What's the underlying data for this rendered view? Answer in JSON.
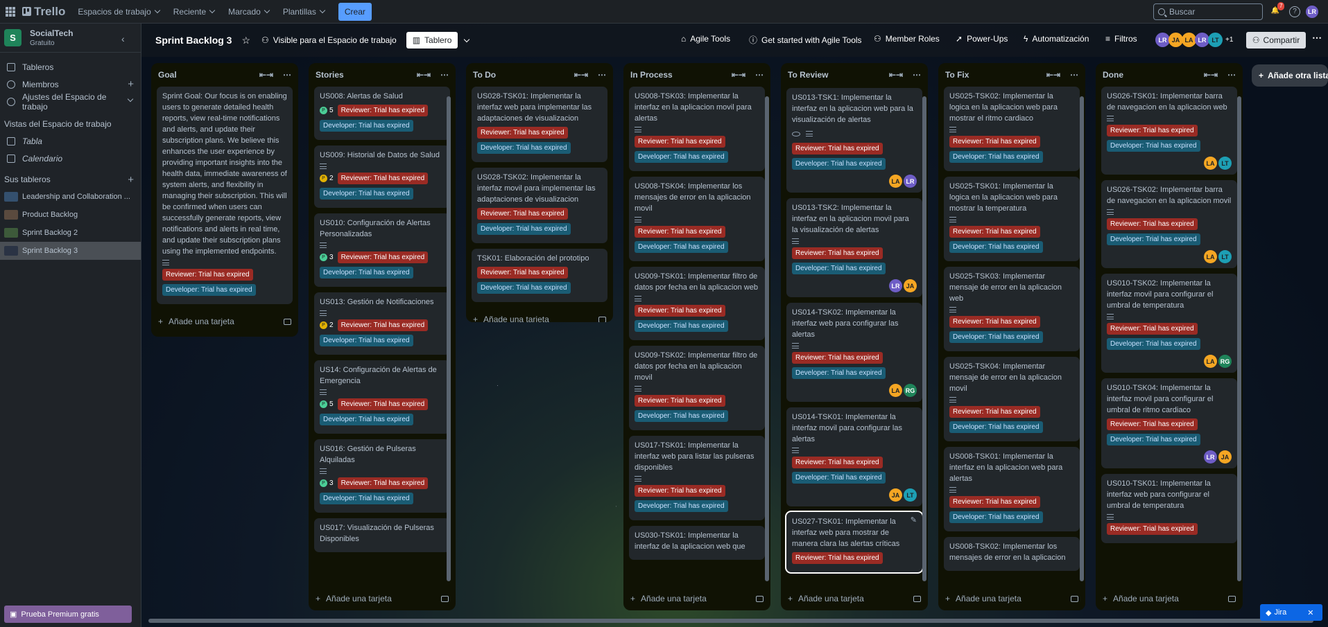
{
  "topbar": {
    "app_name": "Trello",
    "nav": [
      "Espacios de trabajo",
      "Reciente",
      "Marcado",
      "Plantillas"
    ],
    "create_label": "Crear",
    "search_placeholder": "Buscar",
    "notification_count": "7",
    "account_initials": "LR"
  },
  "sidebar": {
    "workspace_initial": "S",
    "workspace_name": "SocialTech",
    "workspace_plan": "Gratuito",
    "items": [
      "Tableros",
      "Miembros",
      "Ajustes del Espacio de trabajo"
    ],
    "views_heading": "Vistas del Espacio de trabajo",
    "views": [
      "Tabla",
      "Calendario"
    ],
    "boards_heading": "Sus tableros",
    "boards": [
      "Leadership and Collaboration ...",
      "Product Backlog",
      "Sprint Backlog 2",
      "Sprint Backlog 3"
    ],
    "premium_label": "Prueba Premium gratis"
  },
  "board_header": {
    "title": "Sprint Backlog 3",
    "visibility": "Visible para el Espacio de trabajo",
    "view": "Tablero",
    "agile_tools": "Agile Tools",
    "get_started": "Get started with Agile Tools",
    "member_roles": "Member Roles",
    "power_ups": "Power-Ups",
    "automation": "Automatización",
    "filters": "Filtros",
    "members": [
      "LR",
      "JA",
      "LA",
      "LR",
      "LT"
    ],
    "more_members": "+1",
    "share_label": "Compartir"
  },
  "labels": {
    "reviewer": "Reviewer: Trial has expired",
    "developer": "Developer: Trial has expired",
    "add_card": "Añade una tarjeta",
    "add_list": "Añade otra lista"
  },
  "colors": {
    "LA": "#f5a623",
    "LR": "#6e5dc6",
    "JA": "#f5a623",
    "RG": "#1f845a",
    "LT": "#1d9fb4"
  },
  "lists": [
    {
      "name": "Goal",
      "cards": [
        {
          "title": "Sprint Goal: Our focus is on enabling users to generate detailed health reports, view real-time notifications and alerts, and update their subscription plans. We believe this enhances the user experience by providing important insights into the health data, immediate awareness of system alerts, and flexibility in managing their subscription. This will be confirmed when users can successfully generate reports, view notifications and alerts in real time, and update their subscription plans using the implemented endpoints."
        }
      ]
    },
    {
      "name": "Stories",
      "cards": [
        {
          "title": "US008: Alertas de Salud",
          "points": "5"
        },
        {
          "title": "US009: Historial de Datos de Salud",
          "points": "2"
        },
        {
          "title": "US010: Configuración de Alertas Personalizadas",
          "points": "3"
        },
        {
          "title": "US013: Gestión de Notificaciones",
          "points": "2"
        },
        {
          "title": "US14: Configuración de Alertas de Emergencia",
          "points": "5"
        },
        {
          "title": "US016: Gestión de Pulseras Alquiladas",
          "points": "3"
        },
        {
          "title": "US017: Visualización de Pulseras Disponibles"
        }
      ]
    },
    {
      "name": "To Do",
      "cards": [
        {
          "title": "US028-TSK01: Implementar la interfaz web para implementar las adaptaciones de visualizacion"
        },
        {
          "title": "US028-TSK02: Implementar la interfaz movil para implementar las adaptaciones de visualizacion"
        },
        {
          "title": "TSK01: Elaboración del prototipo"
        }
      ]
    },
    {
      "name": "In Process",
      "cards": [
        {
          "title": "US008-TSK03: Implementar la interfaz en la aplicacion movil para alertas"
        },
        {
          "title": "US008-TSK04: Implementar los mensajes de error en la aplicacion movil"
        },
        {
          "title": "US009-TSK01: Implementar filtro de datos por fecha en la aplicacion web"
        },
        {
          "title": "US009-TSK02: Implementar filtro de datos por fecha en la aplicacion movil"
        },
        {
          "title": "US017-TSK01: Implementar la interfaz web para listar las pulseras disponibles"
        },
        {
          "title": "US030-TSK01: Implementar la interfaz de la aplicacion web que"
        }
      ]
    },
    {
      "name": "To Review",
      "cards": [
        {
          "title": "US013-TSK1: Implementar la interfaz en la aplicacion web para la visualización de alertas",
          "members": [
            "LA",
            "LR"
          ]
        },
        {
          "title": "US013-TSK2: Implementar la interfaz en la aplicacion movil para la visualización de alertas",
          "members": [
            "LR",
            "JA"
          ]
        },
        {
          "title": "US014-TSK02: Implementar la interfaz web para configurar las alertas",
          "members": [
            "LA",
            "RG"
          ]
        },
        {
          "title": "US014-TSK01: Implementar la interfaz movil para configurar las alertas",
          "members": [
            "JA",
            "LT"
          ]
        },
        {
          "title": "US027-TSK01: Implementar la interfaz web para mostrar de manera clara las alertas críticas"
        }
      ]
    },
    {
      "name": "To Fix",
      "cards": [
        {
          "title": "US025-TSK02: Implementar la logica en la aplicacion web para mostrar el ritmo cardiaco"
        },
        {
          "title": "US025-TSK01: Implementar la logica en la aplicacion web para mostrar la temperatura"
        },
        {
          "title": "US025-TSK03: Implementar mensaje de error en la aplicacion web"
        },
        {
          "title": "US025-TSK04: Implementar mensaje de error en la aplicacion movil"
        },
        {
          "title": "US008-TSK01: Implementar la interfaz en la aplicacion web para alertas"
        },
        {
          "title": "US008-TSK02: Implementar los mensajes de error en la aplicacion"
        }
      ]
    },
    {
      "name": "Done",
      "cards": [
        {
          "title": "US026-TSK01: Implementar barra de navegacion en la aplicacion web",
          "members": [
            "LA",
            "LT"
          ]
        },
        {
          "title": "US026-TSK02: Implementar barra de navegacion en la aplicacion movil",
          "members": [
            "LA",
            "LT"
          ]
        },
        {
          "title": "US010-TSK02: Implementar la interfaz movil para configurar el umbral de temperatura",
          "members": [
            "LA",
            "RG"
          ]
        },
        {
          "title": "US010-TSK04: Implementar la interfaz movil para configurar el umbral de ritmo cardiaco",
          "members": [
            "LR",
            "JA"
          ]
        },
        {
          "title": "US010-TSK01: Implementar la interfaz web para configurar el umbral de temperatura"
        }
      ]
    }
  ],
  "jira_label": "Jira"
}
